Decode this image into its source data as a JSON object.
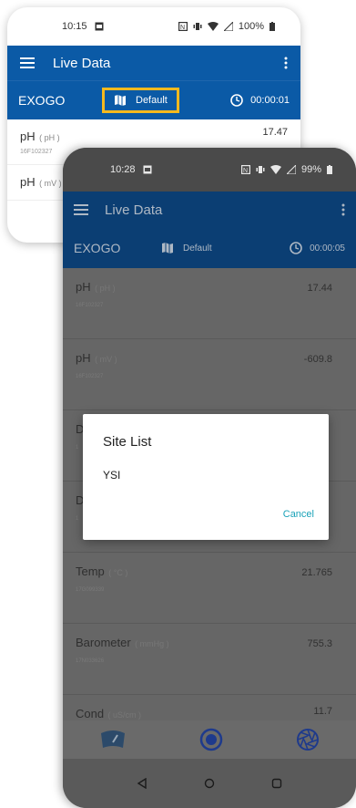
{
  "back_phone": {
    "status": {
      "time": "10:15",
      "battery": "100%"
    },
    "appbar": {
      "title": "Live Data"
    },
    "subbar": {
      "device": "EXOGO",
      "profile": "Default",
      "timer": "00:00:01"
    },
    "rows": [
      {
        "name": "pH",
        "unit": "( pH )",
        "serial": "16F102327",
        "value": "17.47"
      },
      {
        "name": "pH",
        "unit": "( mV )",
        "serial": "",
        "value": ""
      }
    ]
  },
  "front_phone": {
    "status": {
      "time": "10:28",
      "battery": "99%"
    },
    "appbar": {
      "title": "Live Data"
    },
    "subbar": {
      "device": "EXOGO",
      "profile": "Default",
      "timer": "00:00:05"
    },
    "rows": [
      {
        "name": "pH",
        "unit": "( pH )",
        "serial": "16F102327",
        "value": "17.44"
      },
      {
        "name": "pH",
        "unit": "( mV )",
        "serial": "16F102327",
        "value": "-609.8"
      },
      {
        "name": "D",
        "unit": "",
        "serial": "1",
        "value": ""
      },
      {
        "name": "D",
        "unit": "",
        "serial": "1",
        "value": ""
      },
      {
        "name": "Temp",
        "unit": "( °C )",
        "serial": "17G099339",
        "value": "21.765"
      },
      {
        "name": "Barometer",
        "unit": "( mmHg )",
        "serial": "17N033626",
        "value": "755.3"
      },
      {
        "name": "Cond",
        "unit": "( uS/cm )",
        "serial": "",
        "value": "11.7"
      }
    ]
  },
  "dialog": {
    "title": "Site List",
    "items": [
      "YSI"
    ],
    "cancel": "Cancel"
  },
  "colors": {
    "appbar": "#0b5aa6",
    "highlight": "#f5b91e",
    "accent": "#1aa2b8"
  }
}
